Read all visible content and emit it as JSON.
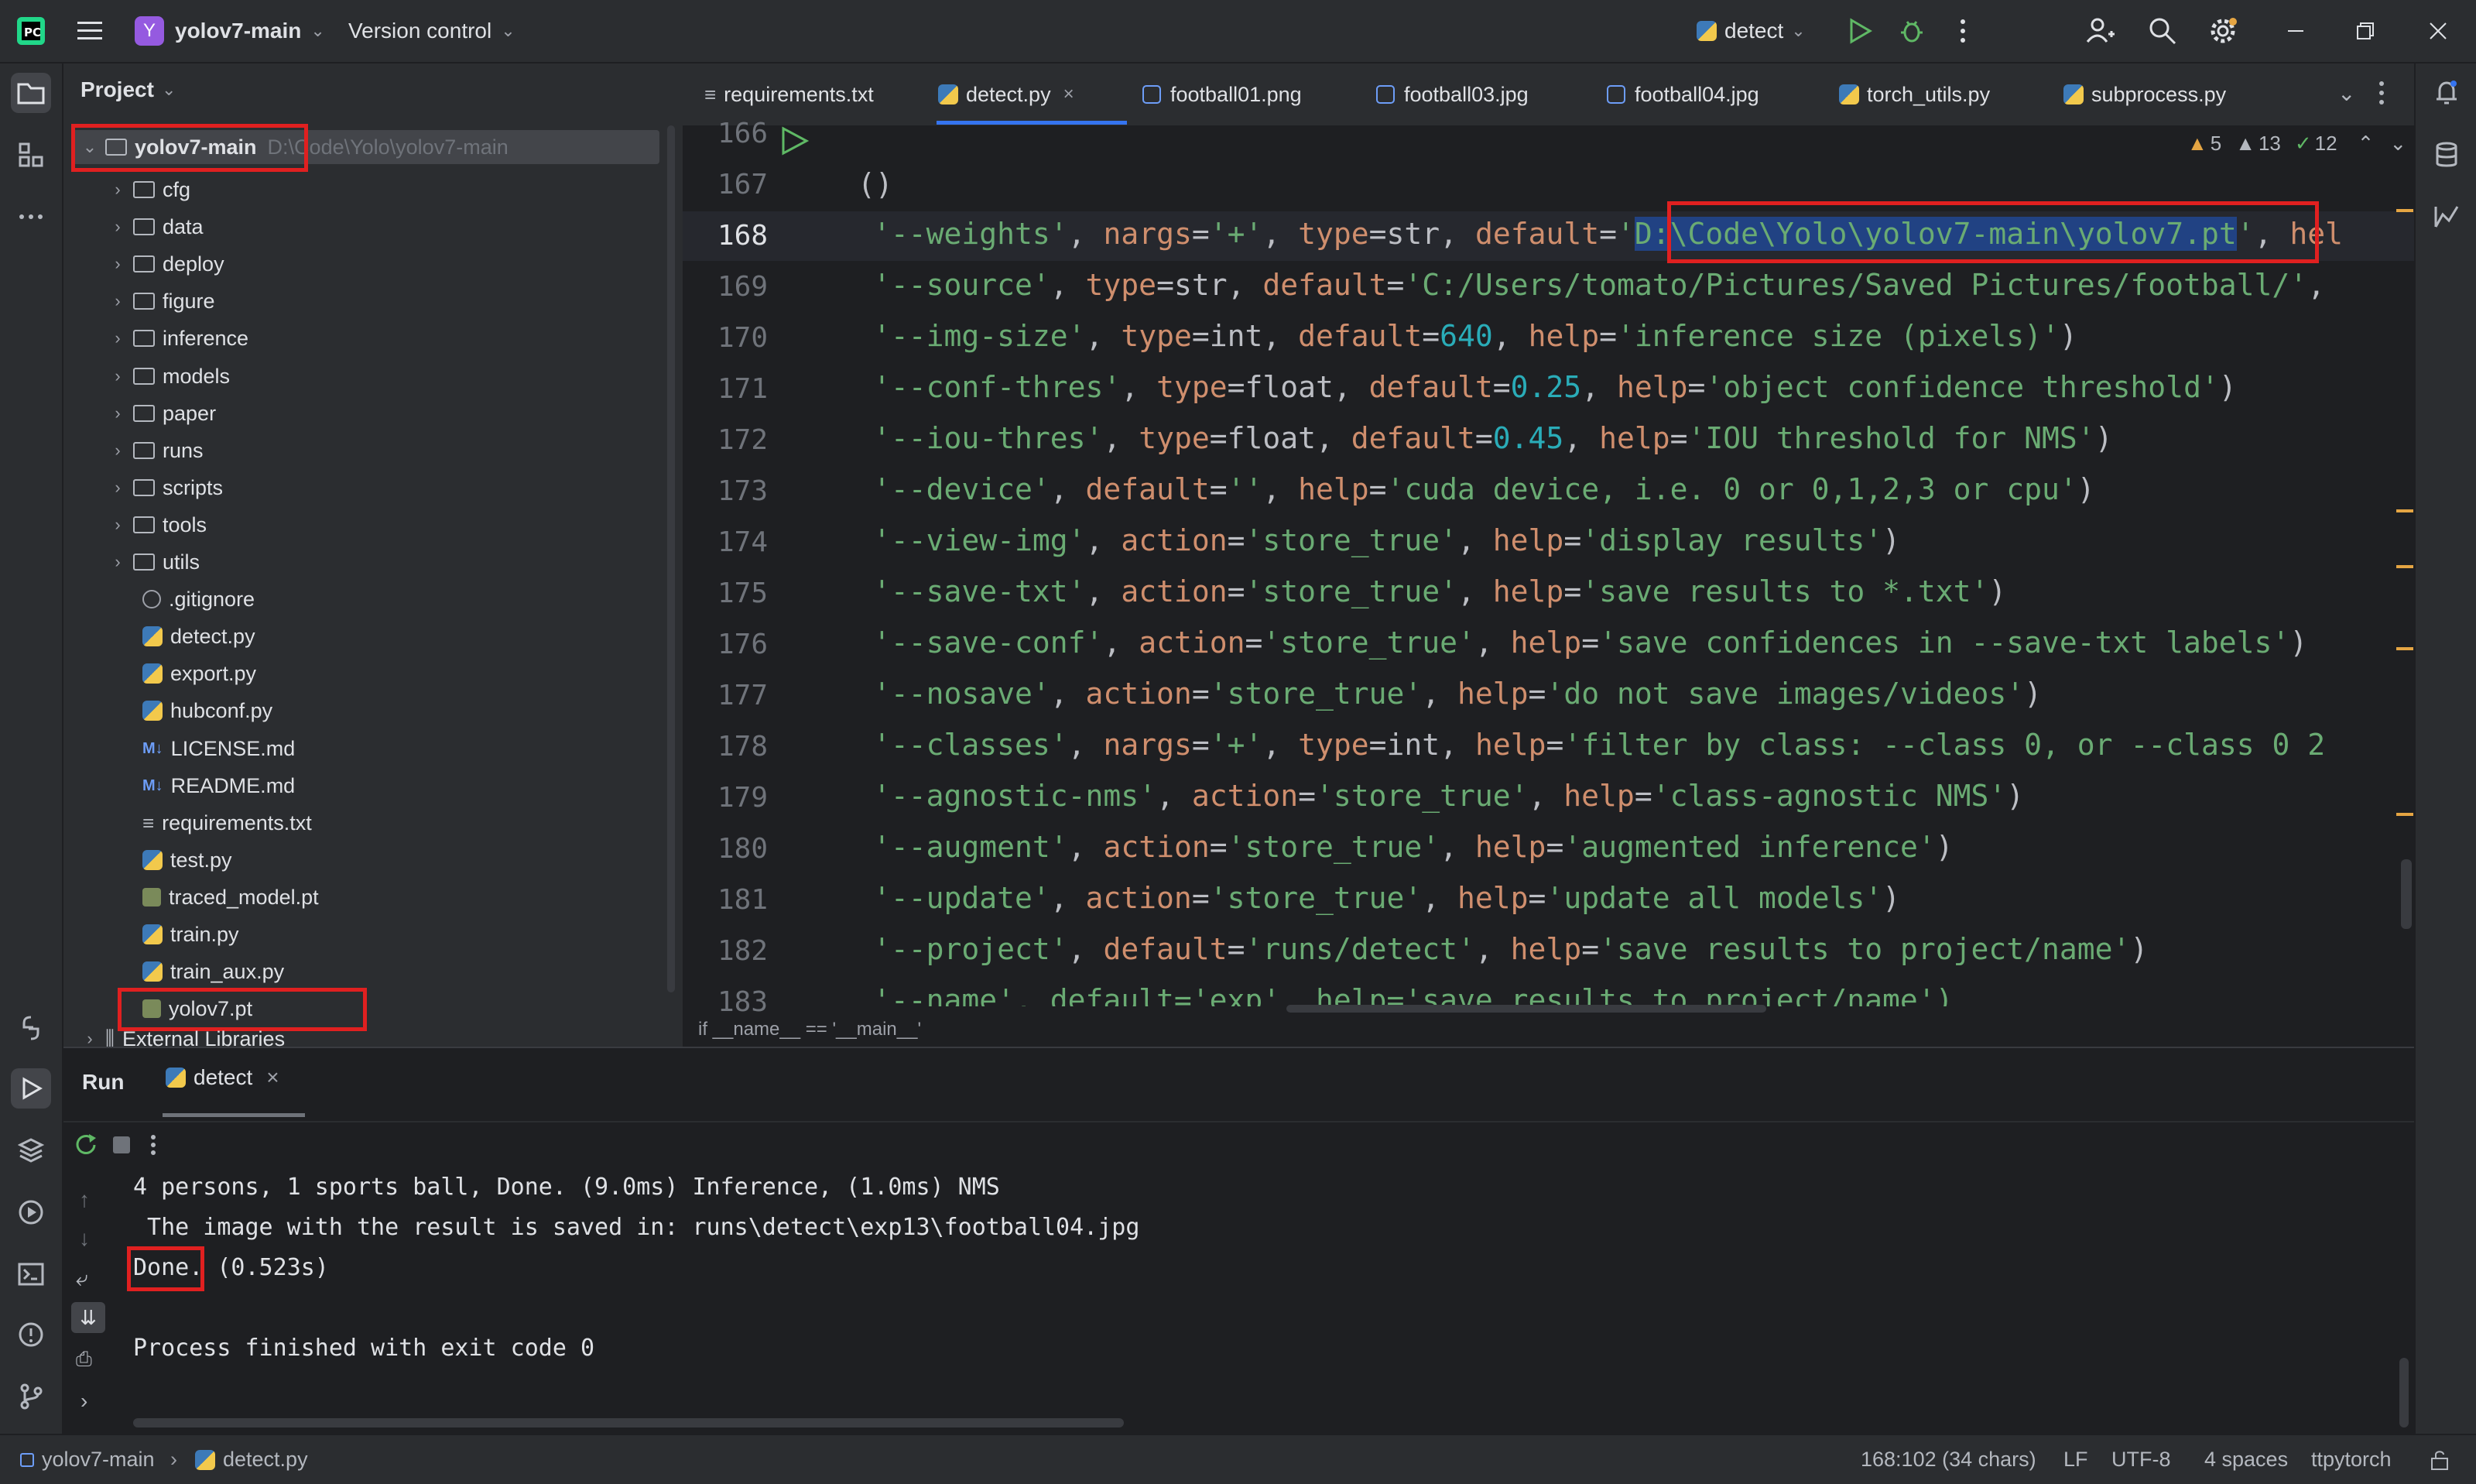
{
  "titlebar": {
    "project_badge": "Y",
    "project_name": "yolov7-main",
    "vcs": "Version control",
    "run_config": "detect"
  },
  "project_panel": {
    "title": "Project",
    "root": {
      "name": "yolov7-main",
      "path": "D:\\Code\\Yolo\\yolov7-main"
    },
    "folders": [
      "cfg",
      "data",
      "deploy",
      "figure",
      "inference",
      "models",
      "paper",
      "runs",
      "scripts",
      "tools",
      "utils"
    ],
    "files": [
      ".gitignore",
      "detect.py",
      "export.py",
      "hubconf.py",
      "LICENSE.md",
      "README.md",
      "requirements.txt",
      "test.py",
      "traced_model.pt",
      "train.py",
      "train_aux.py",
      "yolov7.pt"
    ],
    "external": "External Libraries"
  },
  "tabs": [
    "requirements.txt",
    "detect.py",
    "football01.png",
    "football03.jpg",
    "football04.jpg",
    "torch_utils.py",
    "subprocess.py"
  ],
  "editor": {
    "inspections": {
      "warnings": "5",
      "weak_warnings": "13",
      "typos": "12"
    },
    "line_numbers": [
      "166",
      "167",
      "168",
      "169",
      "170",
      "171",
      "172",
      "173",
      "174",
      "175",
      "176",
      "177",
      "178",
      "179",
      "180",
      "181",
      "182",
      "183"
    ],
    "line_167": "()",
    "line_168": {
      "opt": "'--weights'",
      "nargs": "'+'",
      "type": "str",
      "default_val": "D:\\Code\\Yolo\\yolov7-main\\yolov7.pt",
      "tail": "hel"
    },
    "line_169": {
      "opt": "'--source'",
      "type": "str",
      "default_val": "'C:/Users/tomato/Pictures/Saved Pictures/football/'"
    },
    "line_170": {
      "opt": "'--img-size'",
      "type": "int",
      "default_val": "640",
      "help": "'inference size (pixels)'"
    },
    "line_171": {
      "opt": "'--conf-thres'",
      "type": "float",
      "default_val": "0.25",
      "help": "'object confidence threshold'"
    },
    "line_172": {
      "opt": "'--iou-thres'",
      "type": "float",
      "default_val": "0.45",
      "help": "'IOU threshold for NMS'"
    },
    "line_173": {
      "opt": "'--device'",
      "default_val": "''",
      "help": "'cuda device, i.e. 0 or 0,1,2,3 or cpu'"
    },
    "line_174": {
      "opt": "'--view-img'",
      "action": "'store_true'",
      "help": "'display results'"
    },
    "line_175": {
      "opt": "'--save-txt'",
      "action": "'store_true'",
      "help": "'save results to *.txt'"
    },
    "line_176": {
      "opt": "'--save-conf'",
      "action": "'store_true'",
      "help": "'save confidences in --save-txt labels'"
    },
    "line_177": {
      "opt": "'--nosave'",
      "action": "'store_true'",
      "help": "'do not save images/videos'"
    },
    "line_178": {
      "opt": "'--classes'",
      "nargs": "'+'",
      "type": "int",
      "help": "'filter by class: --class 0, or --class 0 2"
    },
    "line_179": {
      "opt": "'--agnostic-nms'",
      "action": "'store_true'",
      "help": "'class-agnostic NMS'"
    },
    "line_180": {
      "opt": "'--augment'",
      "action": "'store_true'",
      "help": "'augmented inference'"
    },
    "line_181": {
      "opt": "'--update'",
      "action": "'store_true'",
      "help": "'update all models'"
    },
    "line_182": {
      "opt": "'--project'",
      "default_val": "'runs/detect'",
      "help": "'save results to project/name'"
    },
    "line_183": "'--name', default='exp', help='save results to project/name')",
    "breadcrumb": "if __name__ == '__main__'"
  },
  "run": {
    "title": "Run",
    "tab": "detect",
    "output": [
      "4 persons, 1 sports ball, Done. (9.0ms) Inference, (1.0ms) NMS",
      " The image with the result is saved in: runs\\detect\\exp13\\football04.jpg",
      "Done. (0.523s)",
      "",
      "Process finished with exit code 0"
    ]
  },
  "status": {
    "project": "yolov7-main",
    "file": "detect.py",
    "position": "168:102 (34 chars)",
    "line_sep": "LF",
    "encoding": "UTF-8",
    "indent": "4 spaces",
    "interpreter": "ttpytorch"
  },
  "colors": {
    "highlight": "#e02020",
    "accent": "#3574f0",
    "selection": "#214283"
  }
}
